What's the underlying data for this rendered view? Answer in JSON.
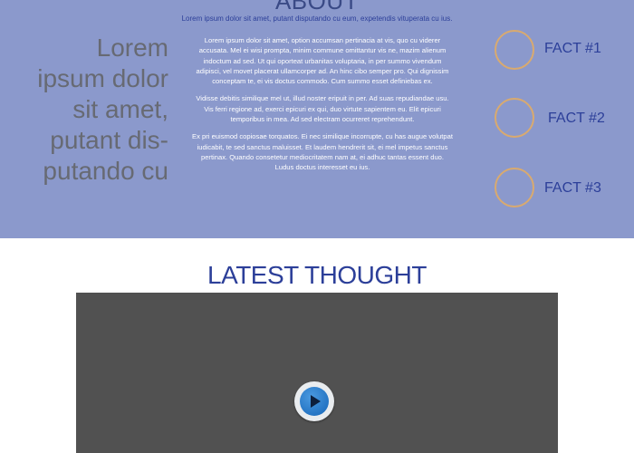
{
  "about": {
    "title": "ABOUT",
    "subtitle": "Lorem ipsum dolor sit amet, putant disputando cu eum, expetendis vituperata cu ius.",
    "pull_quote": [
      "Lorem",
      "ipsum dolor",
      "sit amet,",
      "putant dis-",
      "putando cu"
    ],
    "paragraphs": [
      "Lorem ipsum dolor sit amet, option accumsan pertinacia at vis, quo cu viderer accusata. Mel ei wisi prompta, minim commune omittantur vis ne, mazim alienum indoctum ad sed. Ut qui oporteat urbanitas voluptaria, in per summo vivendum adipisci, vel movet placerat ullamcorper ad. An hinc cibo semper pro. Qui dignissim conceptam te, ei vis doctus commodo. Cum summo esset definiebas ex.",
      "Vidisse debitis similique mel ut, illud noster eripuit in per. Ad suas repudiandae usu. Vis ferri regione ad, exerci epicuri ex qui, duo virtute sapientem eu. Elit epicuri temporibus in mea. Ad sed electram ocurreret reprehendunt.",
      "Ex pri euismod copiosae torquatos. Ei nec similique incorrupte, cu has augue volutpat iudicabit, te sed sanctus maluisset. Et laudem hendrerit sit, ei mel impetus sanctus pertinax. Quando consetetur mediocritatem nam at, ei adhuc tantas essent duo. Ludus doctus interesset eu ius."
    ],
    "facts": [
      "FACT #1",
      "FACT #2",
      "FACT #3"
    ]
  },
  "latest": {
    "title": "LATEST THOUGHT"
  },
  "icons": {
    "fact_icon": "circle-outline-icon",
    "play": "play-icon"
  },
  "colors": {
    "about_bg": "#8b99cc",
    "accent_blue": "#2c3f99",
    "fact_ring": "#d9aa6f",
    "video_bg": "#515151"
  }
}
